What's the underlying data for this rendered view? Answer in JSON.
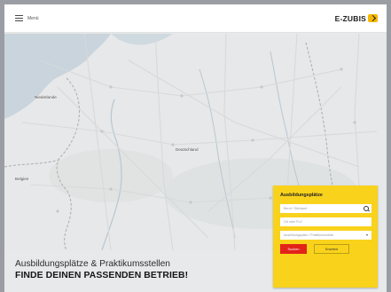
{
  "header": {
    "menu_label": "Menü",
    "logo_text": "E-ZUBIS"
  },
  "map": {
    "labels": {
      "netherlands": "Niederlande",
      "belgium": "Belgien",
      "germany": "Deutschland"
    }
  },
  "search_card": {
    "title": "Ausbildungsplätze",
    "field_what_placeholder": "Beruf / Stichwort",
    "field_where_placeholder": "Ort oder PLZ",
    "field_type_value": "Ausbildungsplatz / Praktikumsstelle",
    "primary_button": "Suchen",
    "secondary_button": "Erweitert"
  },
  "hero": {
    "line1": "Ausbildungsplätze & Praktikumsstellen",
    "line2": "FINDE DEINEN PASSENDEN BETRIEB!"
  },
  "colors": {
    "accent_yellow": "#f9d21c",
    "button_red": "#e2231a",
    "map_land": "#e7e9ea"
  }
}
